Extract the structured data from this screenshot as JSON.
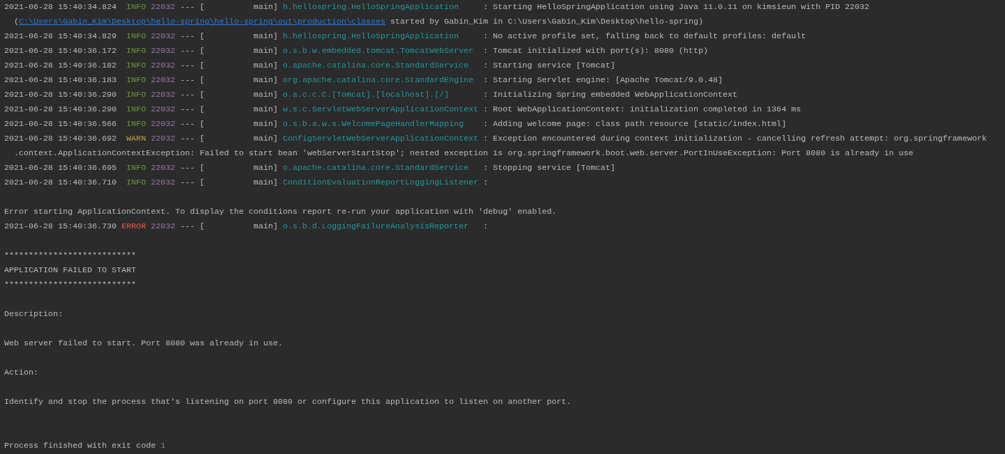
{
  "console": {
    "lines": [
      {
        "kind": "log",
        "time": "2021-06-28 15:40:34.824",
        "color": "#6a9a3a",
        "severity_label": "INFO",
        "pid": "22032",
        "separator": "--- [",
        "thread": "main]",
        "logger": "h.hellospring.HelloSpringApplication",
        "message": ": Starting HelloSpringApplication using Java 11.0.11 on kimsieun with PID 22032"
      },
      {
        "kind": "continuation",
        "prefix": "(",
        "link": "C:\\Users\\Gabin_Kim\\Desktop\\hello-spring\\hello-spring\\out\\production\\classes",
        "text": " started by Gabin_Kim in C:\\Users\\Gabin_Kim\\Desktop\\hello-spring)"
      },
      {
        "kind": "log",
        "time": "2021-06-28 15:40:34.829",
        "color": "#6a9a3a",
        "severity_label": "INFO",
        "pid": "22032",
        "separator": "--- [",
        "thread": "main]",
        "logger": "h.hellospring.HelloSpringApplication",
        "message": ": No active profile set, falling back to default profiles: default"
      },
      {
        "kind": "log",
        "time": "2021-06-28 15:40:36.172",
        "color": "#6a9a3a",
        "severity_label": "INFO",
        "pid": "22032",
        "separator": "--- [",
        "thread": "main]",
        "logger": "o.s.b.w.embedded.tomcat.TomcatWebServer",
        "message": ": Tomcat initialized with port(s): 8080 (http)"
      },
      {
        "kind": "log",
        "time": "2021-06-28 15:40:36.182",
        "color": "#6a9a3a",
        "severity_label": "INFO",
        "pid": "22032",
        "separator": "--- [",
        "thread": "main]",
        "logger": "o.apache.catalina.core.StandardService",
        "message": ": Starting service [Tomcat]"
      },
      {
        "kind": "log",
        "time": "2021-06-28 15:40:36.183",
        "color": "#6a9a3a",
        "severity_label": "INFO",
        "pid": "22032",
        "separator": "--- [",
        "thread": "main]",
        "logger": "org.apache.catalina.core.StandardEngine",
        "message": ": Starting Servlet engine: [Apache Tomcat/9.0.48]"
      },
      {
        "kind": "log",
        "time": "2021-06-28 15:40:36.290",
        "color": "#6a9a3a",
        "severity_label": "INFO",
        "pid": "22032",
        "separator": "--- [",
        "thread": "main]",
        "logger": "o.a.c.c.C.[Tomcat].[localhost].[/]",
        "message": ": Initializing Spring embedded WebApplicationContext"
      },
      {
        "kind": "log",
        "time": "2021-06-28 15:40:36.290",
        "color": "#6a9a3a",
        "severity_label": "INFO",
        "pid": "22032",
        "separator": "--- [",
        "thread": "main]",
        "logger": "w.s.c.ServletWebServerApplicationContext",
        "message": ": Root WebApplicationContext: initialization completed in 1364 ms"
      },
      {
        "kind": "log",
        "time": "2021-06-28 15:40:36.566",
        "color": "#6a9a3a",
        "severity_label": "INFO",
        "pid": "22032",
        "separator": "--- [",
        "thread": "main]",
        "logger": "o.s.b.a.w.s.WelcomePageHandlerMapping",
        "message": ": Adding welcome page: class path resource [static/index.html]"
      },
      {
        "kind": "log",
        "time": "2021-06-28 15:40:36.692",
        "color": "#c4a23b",
        "severity_label": "WARN",
        "pid": "22032",
        "separator": "--- [",
        "thread": "main]",
        "logger": "ConfigServletWebServerApplicationContext",
        "message": ": Exception encountered during context initialization - cancelling refresh attempt: org.springframework"
      },
      {
        "kind": "continuation",
        "text": ".context.ApplicationContextException: Failed to start bean 'webServerStartStop'; nested exception is org.springframework.boot.web.server.PortInUseException: Port 8080 is already in use"
      },
      {
        "kind": "log",
        "time": "2021-06-28 15:40:36.695",
        "color": "#6a9a3a",
        "severity_label": "INFO",
        "pid": "22032",
        "separator": "--- [",
        "thread": "main]",
        "logger": "o.apache.catalina.core.StandardService",
        "message": ": Stopping service [Tomcat]"
      },
      {
        "kind": "log",
        "time": "2021-06-28 15:40:36.710",
        "color": "#6a9a3a",
        "severity_label": "INFO",
        "pid": "22032",
        "separator": "--- [",
        "thread": "main]",
        "logger": "ConditionEvaluationReportLoggingListener",
        "message": ":"
      },
      {
        "kind": "blank"
      },
      {
        "kind": "text",
        "text": "Error starting ApplicationContext. To display the conditions report re-run your application with 'debug' enabled."
      },
      {
        "kind": "log",
        "time": "2021-06-28 15:40:36.730",
        "color": "#e8574f",
        "severity_label": "ERROR",
        "pid": "22032",
        "separator": "--- [",
        "thread": "main]",
        "logger": "o.s.b.d.LoggingFailureAnalysisReporter",
        "message": ":"
      },
      {
        "kind": "blank"
      },
      {
        "kind": "text",
        "text": "***************************"
      },
      {
        "kind": "text",
        "text": "APPLICATION FAILED TO START"
      },
      {
        "kind": "text",
        "text": "***************************"
      },
      {
        "kind": "blank"
      },
      {
        "kind": "text",
        "text": "Description:"
      },
      {
        "kind": "blank"
      },
      {
        "kind": "text",
        "text": "Web server failed to start. Port 8080 was already in use."
      },
      {
        "kind": "blank"
      },
      {
        "kind": "text",
        "text": "Action:"
      },
      {
        "kind": "blank"
      },
      {
        "kind": "text",
        "text": "Identify and stop the process that's listening on port 8080 or configure this application to listen on another port."
      },
      {
        "kind": "blank"
      },
      {
        "kind": "blank"
      },
      {
        "kind": "exit",
        "text": "Process finished with exit code ",
        "code": "1"
      }
    ]
  }
}
